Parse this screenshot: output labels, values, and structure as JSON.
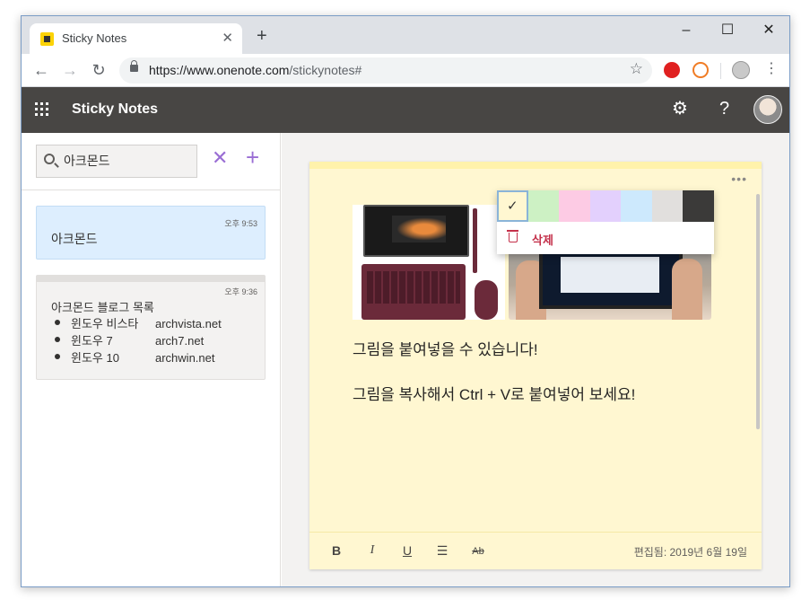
{
  "browser": {
    "tab_title": "Sticky Notes",
    "url_host": "https://www.onenote.com",
    "url_path": "/stickynotes#"
  },
  "app": {
    "title": "Sticky Notes"
  },
  "search": {
    "query": "아크몬드"
  },
  "notes": [
    {
      "time": "오후 9:53",
      "text": "아크몬드"
    },
    {
      "time": "오후 9:36",
      "title": "아크몬드 블로그 목록",
      "items": [
        {
          "name": "윈도우 비스타",
          "site": "archvista.net"
        },
        {
          "name": "윈도우 7",
          "site": "arch7.net"
        },
        {
          "name": "윈도우 10",
          "site": "archwin.net"
        }
      ]
    }
  ],
  "editor": {
    "line1": "그림을 붙여넣을 수 있습니다!",
    "line2": "그림을 복사해서 Ctrl + V로 붙여넣어 보세요!",
    "edited": "편집됨: 2019년 6월 19일",
    "format": {
      "bold": "B",
      "italic": "I",
      "underline": "U",
      "list": "☰",
      "strike": "Ab"
    }
  },
  "color_menu": {
    "colors": [
      "#fff7d1",
      "#cdf1c4",
      "#fdcbe4",
      "#e3d0fd",
      "#cde9fd",
      "#e1dfdd",
      "#3b3a39"
    ],
    "selected_index": 0,
    "delete_label": "삭제"
  }
}
